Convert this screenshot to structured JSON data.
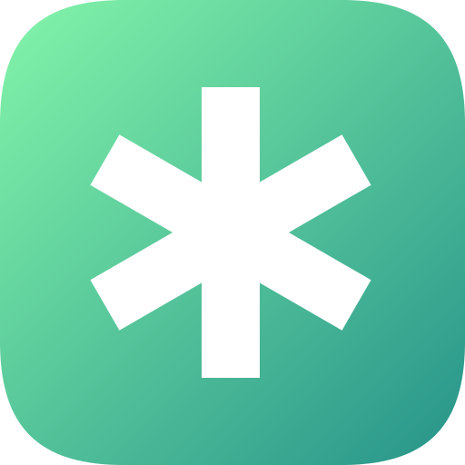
{
  "app_icon": {
    "icon_name": "asterisk-icon",
    "colors": {
      "gradient_start": "#84F5AA",
      "gradient_end": "#26938A",
      "glyph": "#FFFFFF"
    }
  }
}
